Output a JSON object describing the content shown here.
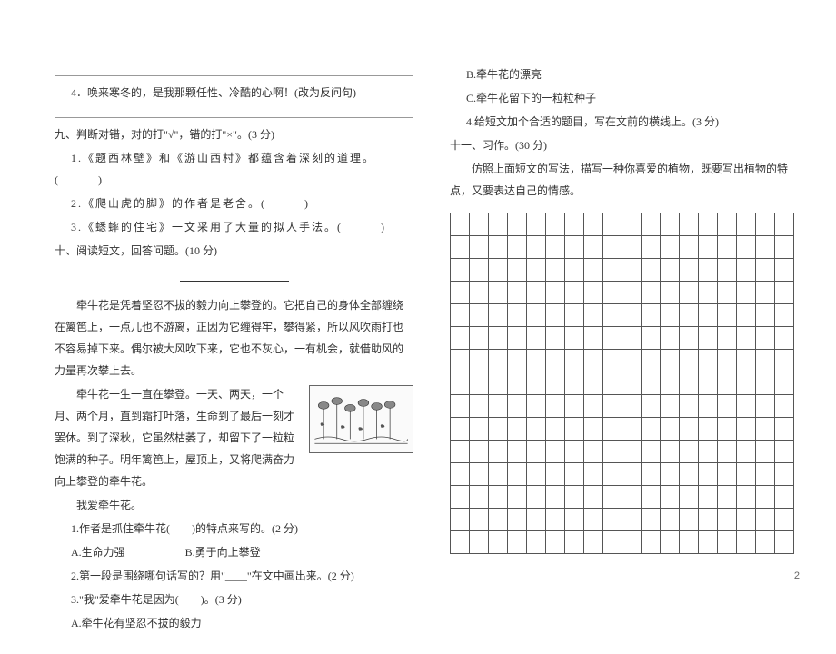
{
  "left": {
    "blank_line": "",
    "q4": "4．唤来寒冬的，是我那颗任性、冷酷的心啊！(改为反问句)",
    "section9_title": "九、判断对错，对的打\"√\"，错的打\"×\"。(3 分)",
    "s9_1": "1.《题西林壁》和《游山西村》都蕴含着深刻的道理。(　　　)",
    "s9_2": "2.《爬山虎的脚》的作者是老舍。(　　　)",
    "s9_3": "3.《蟋蟀的住宅》一文采用了大量的拟人手法。(　　　)",
    "section10_title": "十、阅读短文，回答问题。(10 分)",
    "p1": "牵牛花是凭着坚忍不拔的毅力向上攀登的。它把自己的身体全部缠绕在篱笆上，一点儿也不游离，正因为它缠得牢，攀得紧，所以风吹雨打也不容易掉下来。偶尔被大风吹下来，它也不灰心，一有机会，就借助风的力量再次攀上去。",
    "p2a": "牵牛花一生一直在攀登。一天、两天，一个月、两个月，直到霜打叶落，生命到了最后一刻才罢休。到了深秋，它虽然枯萎了，却留下了一粒粒饱满的种子。明年篱笆上，屋顶上，又将爬满奋力向上攀登的牵牛花。",
    "p3": "我爱牵牛花。",
    "q10_1": "1.作者是抓住牵牛花(　　)的特点来写的。(2 分)",
    "q10_1a": "A.生命力强",
    "q10_1b": "B.勇于向上攀登",
    "q10_2": "2.第一段是围绕哪句话写的？用\"____\"在文中画出来。(2 分)",
    "q10_3": "3.\"我\"爱牵牛花是因为(　　)。(3 分)",
    "q10_3a": "A.牵牛花有坚忍不拔的毅力"
  },
  "right": {
    "q10_3b": "B.牵牛花的漂亮",
    "q10_3c": "C.牵牛花留下的一粒粒种子",
    "q10_4": "4.给短文加个合适的题目，写在文前的横线上。(3 分)",
    "section11_title": "十一、习作。(30 分)",
    "s11_body": "仿照上面短文的写法，描写一种你喜爱的植物，既要写出植物的特点，又要表达自己的情感。"
  },
  "pagenum": "2",
  "grid": {
    "rows": 15,
    "cols": 18
  }
}
